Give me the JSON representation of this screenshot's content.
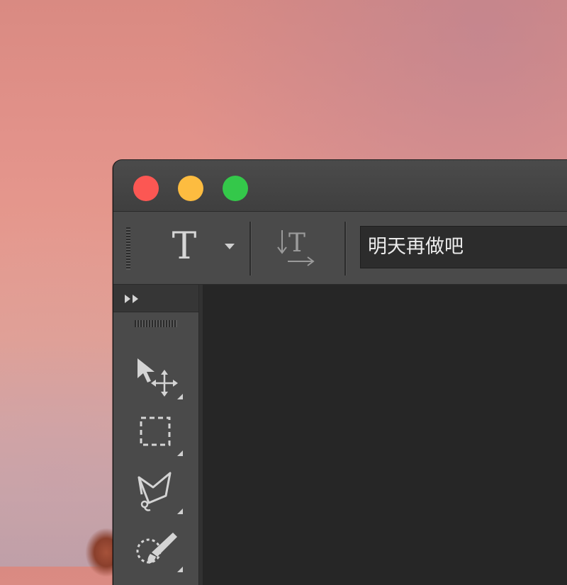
{
  "window": {
    "traffic_lights": {
      "close": "#fc5753",
      "minimize": "#fdbc40",
      "maximize": "#34c84a"
    }
  },
  "options_bar": {
    "tool_icon": "horizontal-type-tool-icon",
    "tool_glyph": "T",
    "orientation_icon": "toggle-text-orientation-icon",
    "text_value": "明天再做吧"
  },
  "tools_panel": {
    "collapse_icon": "double-chevron-right-icon",
    "tools": [
      {
        "icon": "move-tool-icon"
      },
      {
        "icon": "rectangular-marquee-tool-icon"
      },
      {
        "icon": "lasso-tool-icon"
      },
      {
        "icon": "quick-selection-tool-icon"
      }
    ]
  },
  "colors": {
    "window_bg": "#323232",
    "canvas_bg": "#262626",
    "panel_bg": "#4a4a4a"
  }
}
